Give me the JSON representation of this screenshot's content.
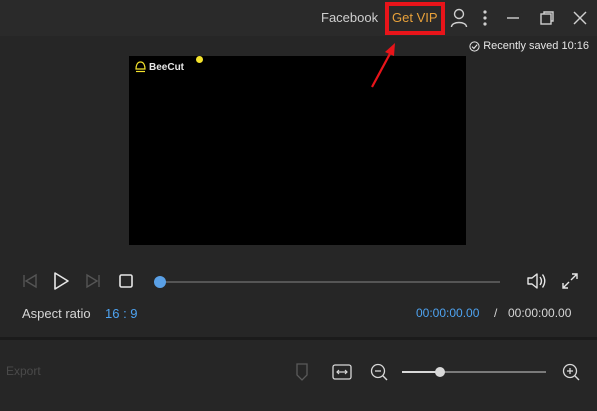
{
  "titlebar": {
    "facebook_label": "Facebook",
    "get_vip_label": "Get VIP",
    "icons": [
      "user-icon",
      "more-vertical-icon",
      "minimize-icon",
      "restore-icon",
      "close-icon"
    ]
  },
  "preview": {
    "saved_text": "Recently saved 10:16",
    "logo_text": "BeeCut"
  },
  "controls": {
    "aspect_label": "Aspect ratio",
    "aspect_value": "16 : 9",
    "current_time": "00:00:00.00",
    "separator": "/",
    "total_time": "00:00:00.00",
    "progress": 0.0
  },
  "bottom": {
    "export_label": "Export",
    "zoom_level": 0.25
  },
  "colors": {
    "accent_blue": "#4ea3f1",
    "vip_orange": "#e8a13a",
    "highlight_red": "#e8141a"
  }
}
